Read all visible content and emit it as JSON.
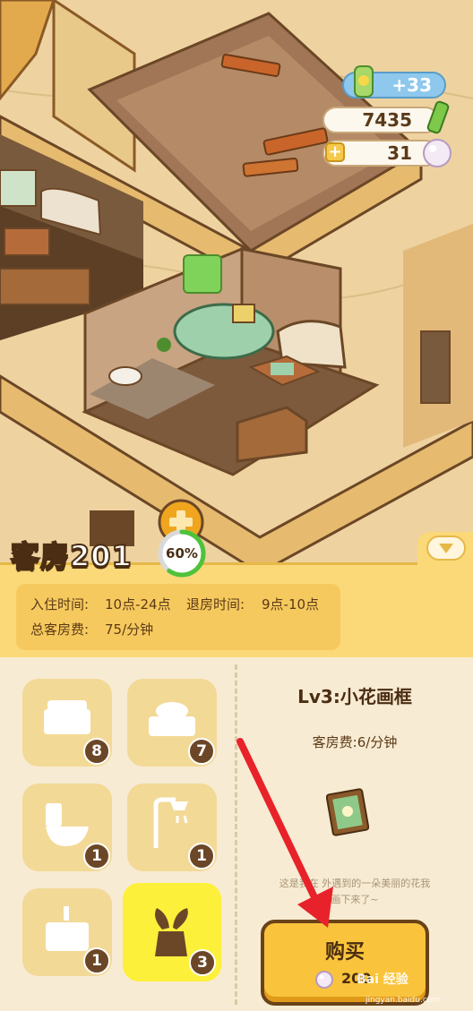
{
  "hud": {
    "energy_label": "+33",
    "coins_value": "7435",
    "pearls_value": "31",
    "plus_symbol": "+"
  },
  "room": {
    "title": "客房201",
    "progress_label": "60%",
    "progress": 0.6,
    "checkin_label": "入住时间:",
    "checkin_value": "10点-24点",
    "checkout_label": "退房时间:",
    "checkout_value": "9点-10点",
    "fee_label": "总客房费:",
    "fee_value": "75/分钟"
  },
  "items": [
    {
      "name": "bed",
      "count": "8"
    },
    {
      "name": "pillow",
      "count": "7"
    },
    {
      "name": "toilet",
      "count": "1"
    },
    {
      "name": "shower",
      "count": "1"
    },
    {
      "name": "nightstand",
      "count": "1"
    },
    {
      "name": "plant",
      "count": "3"
    }
  ],
  "detail": {
    "title": "Lv3:小花画框",
    "fee": "客房费:6/分钟",
    "desc_line1": "这是我在 外遇到的一朵美丽的花我",
    "desc_line2": "画下来了~",
    "buy_label": "购买",
    "price": "200"
  },
  "watermark": {
    "text": "Bai 经验",
    "url": "jingyan.baidu.com"
  },
  "colors": {
    "accent_yellow": "#fbd978",
    "selected_tile": "#fdf03b",
    "arrow_red": "#e8222a",
    "progress_green": "#4fc23a"
  }
}
